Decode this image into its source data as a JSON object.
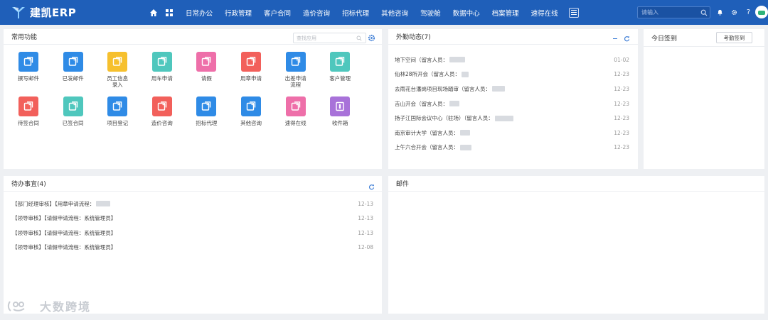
{
  "app": {
    "title": "建凯ERP"
  },
  "nav": {
    "items": [
      "日常办公",
      "行政管理",
      "客户合同",
      "造价咨询",
      "招标代理",
      "其他咨询",
      "驾驶舱",
      "数据中心",
      "档案管理",
      "速得在线"
    ]
  },
  "topbar": {
    "search_placeholder": "请输入",
    "tools": [
      "bell-icon",
      "gear-icon",
      "help-icon"
    ]
  },
  "common": {
    "title": "常用功能",
    "search_placeholder": "查找应用",
    "items": [
      {
        "label": "撰写邮件",
        "color": "#2f8be6"
      },
      {
        "label": "已发邮件",
        "color": "#2f8be6"
      },
      {
        "label": "员工信息录入",
        "color": "#f6c02e"
      },
      {
        "label": "用车申请",
        "color": "#4fc7bd"
      },
      {
        "label": "请假",
        "color": "#ee6fa9"
      },
      {
        "label": "用章申请",
        "color": "#f2605b"
      },
      {
        "label": "出差申请流程",
        "color": "#2f8be6"
      },
      {
        "label": "客户管理",
        "color": "#4fc7bd"
      },
      {
        "label": "待签合同",
        "color": "#f2605b"
      },
      {
        "label": "已签合同",
        "color": "#4fc7bd"
      },
      {
        "label": "项目登记",
        "color": "#2f8be6"
      },
      {
        "label": "造价咨询",
        "color": "#f2605b"
      },
      {
        "label": "招标代理",
        "color": "#2f8be6"
      },
      {
        "label": "其他咨询",
        "color": "#2f8be6"
      },
      {
        "label": "速得在线",
        "color": "#ee6fa9"
      },
      {
        "label": "收件箱",
        "color": "#a872d9"
      }
    ]
  },
  "attendance": {
    "title": "外勤动态(7)",
    "rows": [
      {
        "text": "地下空间（留言人员：",
        "date": "01-02"
      },
      {
        "text": "仙林28所开会（留言人员：",
        "date": "12-23"
      },
      {
        "text": "去雨花台潘岗项目现场踏审（留言人员：",
        "date": "12-23"
      },
      {
        "text": "吉山开会（留言人员：",
        "date": "12-23"
      },
      {
        "text": "扬子江国际会议中心（驻场）（留言人员：",
        "date": "12-23"
      },
      {
        "text": "南京审计大学（留言人员：",
        "date": "12-23"
      },
      {
        "text": "上午六合开会（留言人员：",
        "date": "12-23"
      }
    ]
  },
  "signin": {
    "title": "今日签到",
    "button": "考勤签到"
  },
  "todo": {
    "title": "待办事宜(4)",
    "rows": [
      {
        "text": "【部门经理审核】【用章申请流程：",
        "date": "12-13"
      },
      {
        "text": "【领导审核】【请假申请流程：系统管理员】",
        "date": "12-13"
      },
      {
        "text": "【领导审核】【请假申请流程：系统管理员】",
        "date": "12-13"
      },
      {
        "text": "【领导审核】【请假申请流程：系统管理员】",
        "date": "12-08"
      }
    ]
  },
  "mail": {
    "title": "邮件"
  },
  "watermark": {
    "text": "大数跨境"
  }
}
